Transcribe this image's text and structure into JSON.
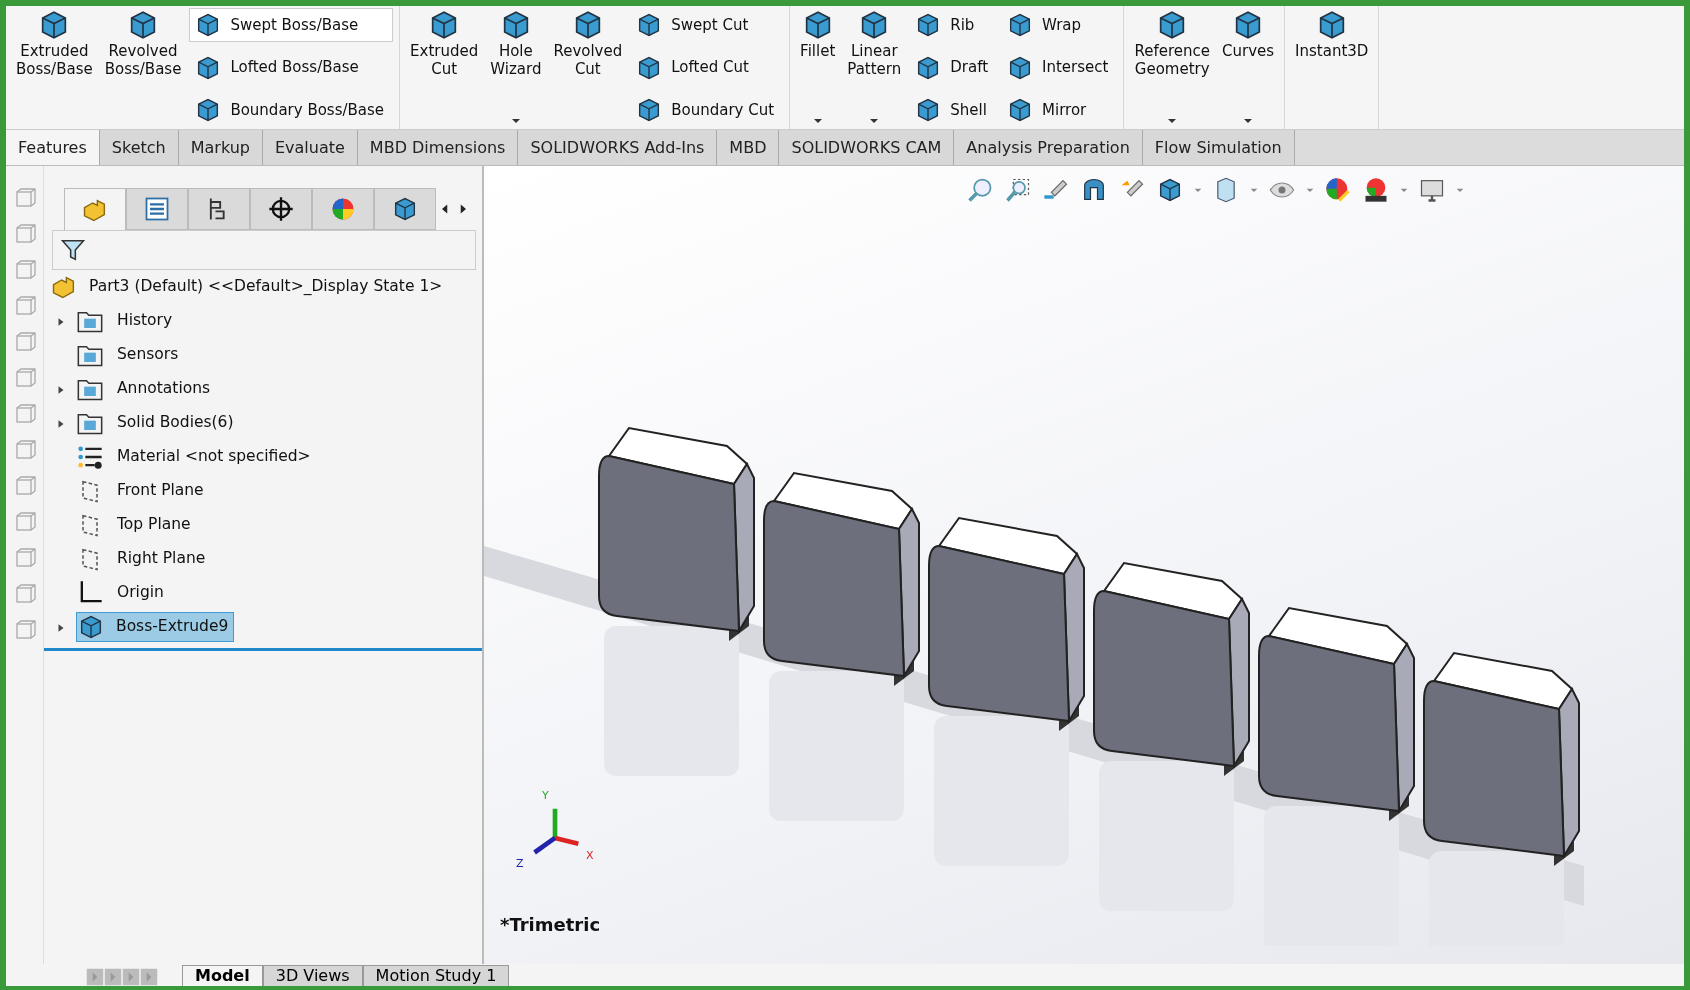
{
  "ribbon": {
    "groups": [
      {
        "columns": [
          {
            "kind": "large",
            "label": "Extruded Boss/Base",
            "dropdown": false
          },
          {
            "kind": "large",
            "label": "Revolved Boss/Base",
            "dropdown": false
          },
          {
            "kind": "stack",
            "items": [
              {
                "label": "Swept Boss/Base",
                "highlighted": true
              },
              {
                "label": "Lofted Boss/Base",
                "highlighted": false
              },
              {
                "label": "Boundary Boss/Base",
                "highlighted": false
              }
            ]
          }
        ]
      },
      {
        "columns": [
          {
            "kind": "large",
            "label": "Extruded Cut",
            "dropdown": false
          },
          {
            "kind": "large",
            "label": "Hole Wizard",
            "dropdown": true
          },
          {
            "kind": "large",
            "label": "Revolved Cut",
            "dropdown": false
          },
          {
            "kind": "stack",
            "items": [
              {
                "label": "Swept Cut",
                "highlighted": false
              },
              {
                "label": "Lofted Cut",
                "highlighted": false
              },
              {
                "label": "Boundary Cut",
                "highlighted": false
              }
            ]
          }
        ]
      },
      {
        "columns": [
          {
            "kind": "large",
            "label": "Fillet",
            "dropdown": true
          },
          {
            "kind": "large",
            "label": "Linear Pattern",
            "dropdown": true
          },
          {
            "kind": "stack",
            "items": [
              {
                "label": "Rib",
                "highlighted": false
              },
              {
                "label": "Draft",
                "highlighted": false
              },
              {
                "label": "Shell",
                "highlighted": false
              }
            ]
          },
          {
            "kind": "stack",
            "items": [
              {
                "label": "Wrap",
                "highlighted": false
              },
              {
                "label": "Intersect",
                "highlighted": false
              },
              {
                "label": "Mirror",
                "highlighted": false
              }
            ]
          }
        ]
      },
      {
        "columns": [
          {
            "kind": "large",
            "label": "Reference Geometry",
            "dropdown": true
          },
          {
            "kind": "large",
            "label": "Curves",
            "dropdown": true
          }
        ]
      },
      {
        "columns": [
          {
            "kind": "large",
            "label": "Instant3D",
            "dropdown": false
          }
        ]
      }
    ]
  },
  "tabs": [
    {
      "label": "Features",
      "selected": true
    },
    {
      "label": "Sketch",
      "selected": false
    },
    {
      "label": "Markup",
      "selected": false
    },
    {
      "label": "Evaluate",
      "selected": false
    },
    {
      "label": "MBD Dimensions",
      "selected": false
    },
    {
      "label": "SOLIDWORKS Add-Ins",
      "selected": false
    },
    {
      "label": "MBD",
      "selected": false
    },
    {
      "label": "SOLIDWORKS CAM",
      "selected": false
    },
    {
      "label": "Analysis Preparation",
      "selected": false
    },
    {
      "label": "Flow Simulation",
      "selected": false
    }
  ],
  "panel_tabs": [
    {
      "kind": "part",
      "selected": true
    },
    {
      "kind": "property",
      "selected": false
    },
    {
      "kind": "config",
      "selected": false
    },
    {
      "kind": "dim",
      "selected": false
    },
    {
      "kind": "display",
      "selected": false
    },
    {
      "kind": "cam",
      "selected": false
    }
  ],
  "tree": {
    "root": "Part3 (Default) <<Default>_Display State 1>",
    "items": [
      {
        "label": "History",
        "kind": "folder",
        "expandable": true,
        "selected": false
      },
      {
        "label": "Sensors",
        "kind": "folder",
        "expandable": false,
        "selected": false
      },
      {
        "label": "Annotations",
        "kind": "folder",
        "expandable": true,
        "selected": false
      },
      {
        "label": "Solid Bodies(6)",
        "kind": "folder",
        "expandable": true,
        "selected": false
      },
      {
        "label": "Material <not specified>",
        "kind": "material",
        "expandable": false,
        "selected": false
      },
      {
        "label": "Front Plane",
        "kind": "plane",
        "expandable": false,
        "selected": false
      },
      {
        "label": "Top Plane",
        "kind": "plane",
        "expandable": false,
        "selected": false
      },
      {
        "label": "Right Plane",
        "kind": "plane",
        "expandable": false,
        "selected": false
      },
      {
        "label": "Origin",
        "kind": "origin",
        "expandable": false,
        "selected": false
      },
      {
        "label": "Boss-Extrude9",
        "kind": "feature",
        "expandable": true,
        "selected": true
      }
    ]
  },
  "viewport": {
    "view_name": "*Trimetric",
    "triad": {
      "y": "Y",
      "x": "X",
      "z": "Z"
    }
  },
  "bottom_tabs": [
    {
      "label": "Model",
      "selected": true
    },
    {
      "label": "3D Views",
      "selected": false
    },
    {
      "label": "Motion Study 1",
      "selected": false
    }
  ]
}
